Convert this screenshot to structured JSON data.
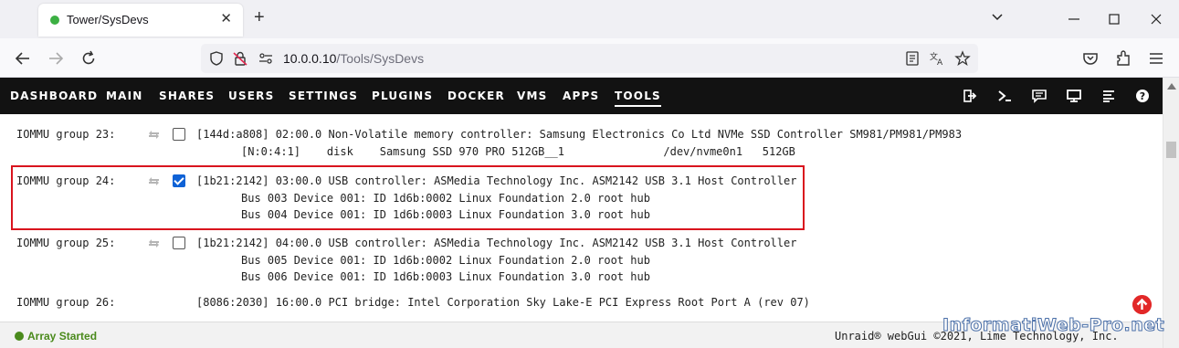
{
  "browser": {
    "tab_title": "Tower/SysDevs",
    "url_host": "10.0.0.10",
    "url_path": "/Tools/SysDevs"
  },
  "nav": {
    "items": [
      "DASHBOARD",
      "MAIN",
      "SHARES",
      "USERS",
      "SETTINGS",
      "PLUGINS",
      "DOCKER",
      "VMS",
      "APPS",
      "TOOLS"
    ],
    "active": "TOOLS"
  },
  "groups": [
    {
      "label": "IOMMU group 23:",
      "checked": false,
      "device": "[144d:a808] 02:00.0 Non-Volatile memory controller: Samsung Electronics Co Ltd NVMe SSD Controller SM981/PM981/PM983",
      "sublines": [
        "[N:0:4:1]    disk    Samsung SSD 970 PRO 512GB__1               /dev/nvme0n1   512GB"
      ]
    },
    {
      "label": "IOMMU group 24:",
      "checked": true,
      "device": "[1b21:2142] 03:00.0 USB controller: ASMedia Technology Inc. ASM2142 USB 3.1 Host Controller",
      "sublines": [
        "Bus 003 Device 001: ID 1d6b:0002 Linux Foundation 2.0 root hub",
        "Bus 004 Device 001: ID 1d6b:0003 Linux Foundation 3.0 root hub"
      ]
    },
    {
      "label": "IOMMU group 25:",
      "checked": false,
      "device": "[1b21:2142] 04:00.0 USB controller: ASMedia Technology Inc. ASM2142 USB 3.1 Host Controller",
      "sublines": [
        "Bus 005 Device 001: ID 1d6b:0002 Linux Foundation 2.0 root hub",
        "Bus 006 Device 001: ID 1d6b:0003 Linux Foundation 3.0 root hub"
      ]
    },
    {
      "label": "IOMMU group 26:",
      "device": "[8086:2030] 16:00.0 PCI bridge: Intel Corporation Sky Lake-E PCI Express Root Port A (rev 07)"
    }
  ],
  "footer": {
    "array_status": "Array Started",
    "copyright": "Unraid® webGui ©2021, Lime Technology, Inc."
  },
  "watermark": "InformatiWeb-Pro.net",
  "colors": {
    "navbar": "#121212",
    "highlight": "#d9141e",
    "checkbox_on": "#0f62d6",
    "status_green": "#4a8a1c"
  }
}
